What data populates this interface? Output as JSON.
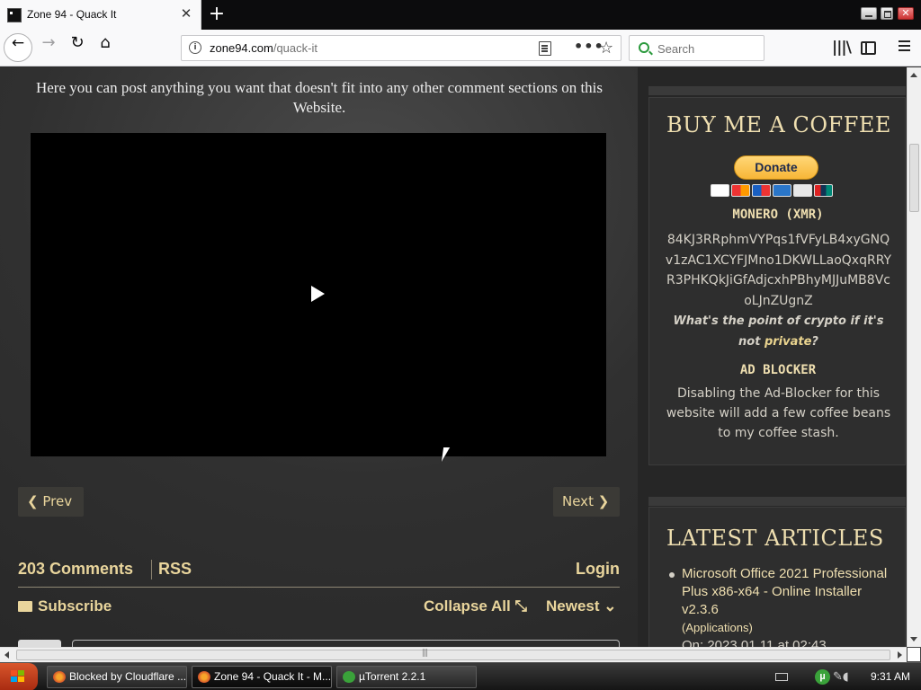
{
  "browser": {
    "tab_title": "Zone 94 - Quack It",
    "new_tab_label": "+",
    "url_host": "zone94.com",
    "url_path": "/quack-it",
    "search_placeholder": "Search"
  },
  "page": {
    "intro_text": "Here you can post anything you want that doesn't fit into any other comment sections on this Website.",
    "prev_label": "Prev",
    "next_label": "Next",
    "comments_count": "203 Comments",
    "rss_label": "RSS",
    "login_label": "Login",
    "subscribe_label": "Subscribe",
    "collapse_label": "Collapse All",
    "sort_label": "Newest"
  },
  "sidebar": {
    "coffee_title": "BUY ME A COFFEE",
    "donate_label": "Donate",
    "monero_label": "MONERO (XMR)",
    "monero_address": "84KJ3RRphmVYPqs1fVFyLB4xyGNQv1zAC1XCYFJMno1DKWLLaoQxqRRYR3PHKQkJiGfAdjcxhPBhyMJJuMB8VcoLJnZUgnZ",
    "crypto_quote_a": "What's the point of crypto if it's not ",
    "crypto_quote_b": "private",
    "crypto_quote_c": "?",
    "adblock_label": "AD BLOCKER",
    "adblock_text": "Disabling the Ad-Blocker for this website will add a few coffee beans to my coffee stash.",
    "articles_title": "LATEST ARTICLES",
    "article_1_title": "Microsoft Office 2021 Professional Plus x86-x64 - Online Installer v2.3.6",
    "article_1_category": "Applications",
    "article_1_date": "On: 2023.01.11 at 02:43"
  },
  "taskbar": {
    "tasks": [
      {
        "label": "Blocked by Cloudflare ..."
      },
      {
        "label": "Zone 94 - Quack It - M..."
      },
      {
        "label": "µTorrent 2.2.1"
      }
    ],
    "clock": "9:31 AM"
  },
  "colors": {
    "accent_gold": "#e9d59c",
    "page_bg": "#2b2b2b",
    "donate_yellow": "#f7b637"
  }
}
